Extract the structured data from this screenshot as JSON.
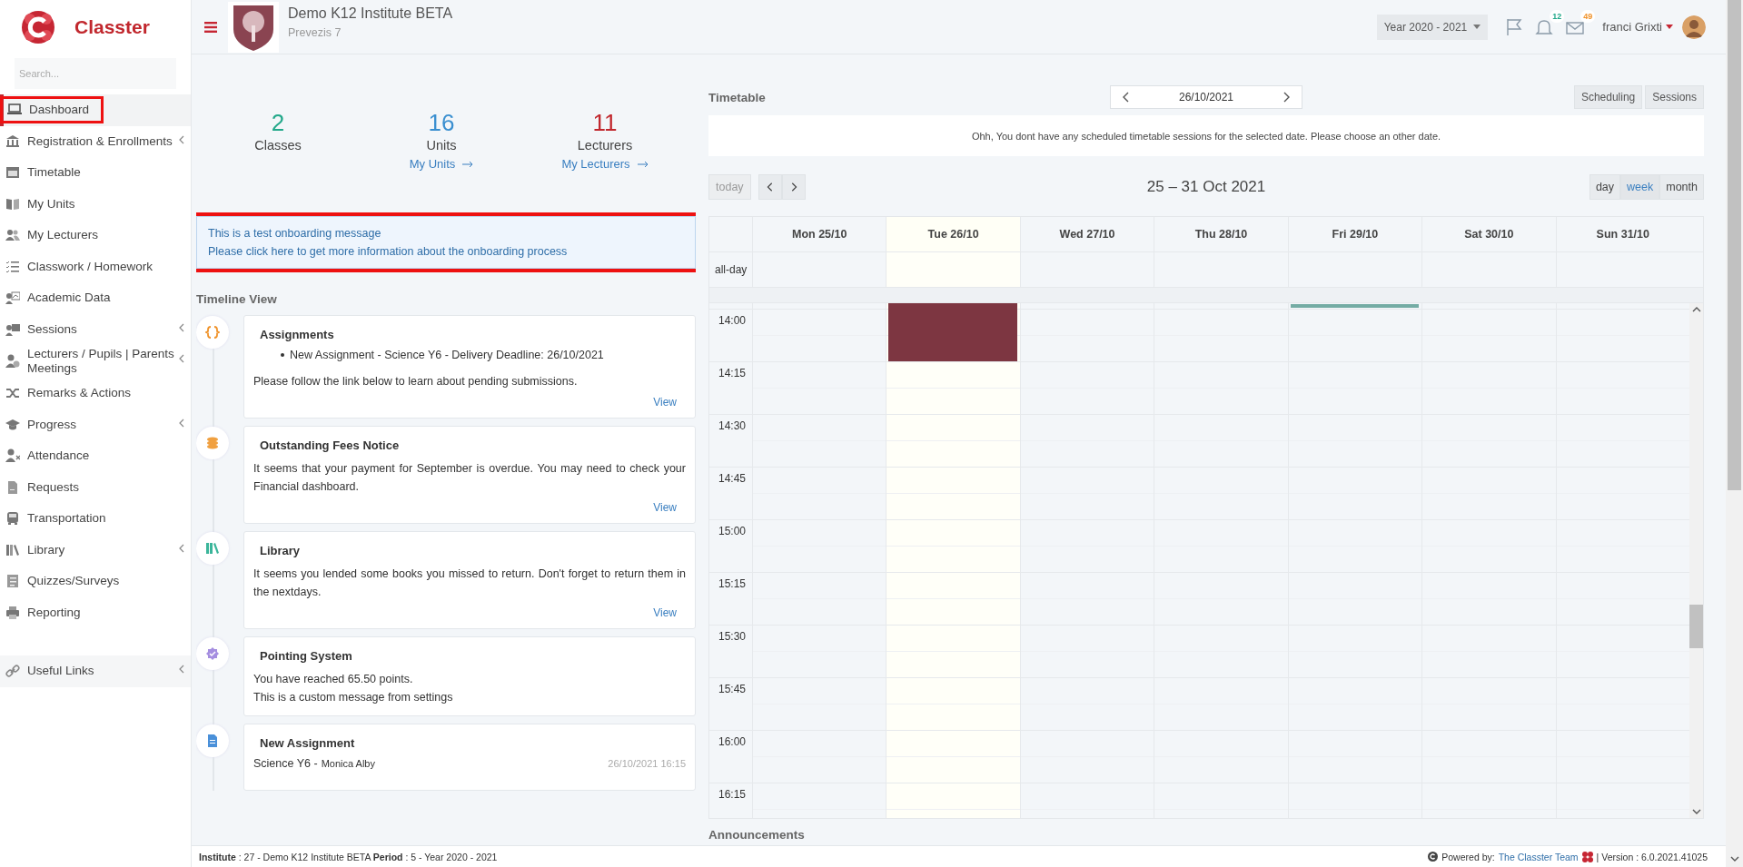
{
  "sidebar": {
    "brand": "Classter",
    "search": {
      "placeholder": "Search..."
    },
    "items": [
      {
        "label": "Dashboard",
        "selected": true,
        "highlighted": true,
        "submenu": false
      },
      {
        "label": "Registration & Enrollments",
        "selected": false,
        "highlighted": false,
        "submenu": true
      },
      {
        "label": "Timetable",
        "selected": false,
        "highlighted": false,
        "submenu": false
      },
      {
        "label": "My Units",
        "selected": false,
        "highlighted": false,
        "submenu": false
      },
      {
        "label": "My Lecturers",
        "selected": false,
        "highlighted": false,
        "submenu": false
      },
      {
        "label": "Classwork / Homework",
        "selected": false,
        "highlighted": false,
        "submenu": false
      },
      {
        "label": "Academic Data",
        "selected": false,
        "highlighted": false,
        "submenu": false
      },
      {
        "label": "Sessions",
        "selected": false,
        "highlighted": false,
        "submenu": true
      },
      {
        "label": "Lecturers / Pupils | Parents Meetings",
        "selected": false,
        "highlighted": false,
        "submenu": true
      },
      {
        "label": "Remarks & Actions",
        "selected": false,
        "highlighted": false,
        "submenu": false
      },
      {
        "label": "Progress",
        "selected": false,
        "highlighted": false,
        "submenu": true
      },
      {
        "label": "Attendance",
        "selected": false,
        "highlighted": false,
        "submenu": false
      },
      {
        "label": "Requests",
        "selected": false,
        "highlighted": false,
        "submenu": false
      },
      {
        "label": "Transportation",
        "selected": false,
        "highlighted": false,
        "submenu": false
      },
      {
        "label": "Library",
        "selected": false,
        "highlighted": false,
        "submenu": true
      },
      {
        "label": "Quizzes/Surveys",
        "selected": false,
        "highlighted": false,
        "submenu": false
      },
      {
        "label": "Reporting",
        "selected": false,
        "highlighted": false,
        "submenu": false
      }
    ],
    "links": [
      {
        "label": "Useful Links",
        "submenu": true
      }
    ]
  },
  "header": {
    "institute": "Demo K12 Institute BETA",
    "subtitle": "Prevezis 7",
    "year": "Year 2020 - 2021",
    "notifications": "12",
    "messages": "49",
    "user": "franci Grixti"
  },
  "stats": [
    {
      "value": "2",
      "label": "Classes",
      "color": "#22a88a"
    },
    {
      "value": "16",
      "label": "Units",
      "link": "My Units",
      "color": "#3a8fd0"
    },
    {
      "value": "11",
      "label": "Lecturers",
      "link": "My Lecturers",
      "color": "#c1272d"
    }
  ],
  "onboarding": {
    "highlighted": true,
    "lines": [
      "This is a test onboarding message",
      "Please click here to get more information about the onboarding process"
    ]
  },
  "timeline": {
    "title": "Timeline View",
    "entries": [
      {
        "title": "Assignments",
        "bullets": [
          "New Assignment - Science Y6 - Delivery Deadline: 26/10/2021"
        ],
        "text": [
          "Please follow the link below to learn about pending submissions."
        ],
        "link": "View"
      },
      {
        "title": "Outstanding Fees Notice",
        "text": [
          "It seems that your payment for September is overdue. You may need to check your Financial dashboard."
        ],
        "link": "View"
      },
      {
        "title": "Library",
        "text": [
          "It seems you lended some books you missed to return. Don't forget to return them in the nextdays."
        ],
        "link": "View"
      },
      {
        "title": "Pointing System",
        "text": [
          "You have reached 65.50 points.",
          "This is a custom message from settings"
        ]
      },
      {
        "title": "New Assignment",
        "subject": "Science Y6 -",
        "author": "Monica Alby",
        "time": "26/10/2021 16:15"
      }
    ]
  },
  "timetable": {
    "title": "Timetable",
    "date": "26/10/2021",
    "buttons": [
      "Scheduling",
      "Sessions"
    ],
    "message": "Ohh, You dont have any scheduled timetable sessions for the selected date. Please choose an other date.",
    "calendar": {
      "today_button": "today",
      "range": "25 – 31 Oct 2021",
      "views": [
        {
          "label": "day",
          "selected": false
        },
        {
          "label": "week",
          "selected": true
        },
        {
          "label": "month",
          "selected": false
        }
      ],
      "all_day_label": "all-day",
      "days": [
        {
          "label": "Mon 25/10",
          "today": false
        },
        {
          "label": "Tue 26/10",
          "today": true,
          "events": [
            {
              "kind": "block",
              "color": "#7d3641"
            }
          ]
        },
        {
          "label": "Wed 27/10",
          "today": false
        },
        {
          "label": "Thu 28/10",
          "today": false
        },
        {
          "label": "Fri 29/10",
          "today": false,
          "events": [
            {
              "kind": "bar",
              "color": "#74aca4"
            }
          ]
        },
        {
          "label": "Sat 30/10",
          "today": false
        },
        {
          "label": "Sun 31/10",
          "today": false
        }
      ],
      "times": [
        "14:00",
        "14:15",
        "14:30",
        "14:45",
        "15:00",
        "15:15",
        "15:30",
        "15:45",
        "16:00",
        "16:15"
      ]
    }
  },
  "announcements": {
    "title": "Announcements"
  },
  "footer": {
    "info": "**Institute** : 27 - Demo K12 Institute BETA **Period** : 5 - Year 2020 - 2021",
    "powered_by": "Powered by:",
    "team": "The Classter Team",
    "version": "| Version : 6.0.2021.41025"
  }
}
